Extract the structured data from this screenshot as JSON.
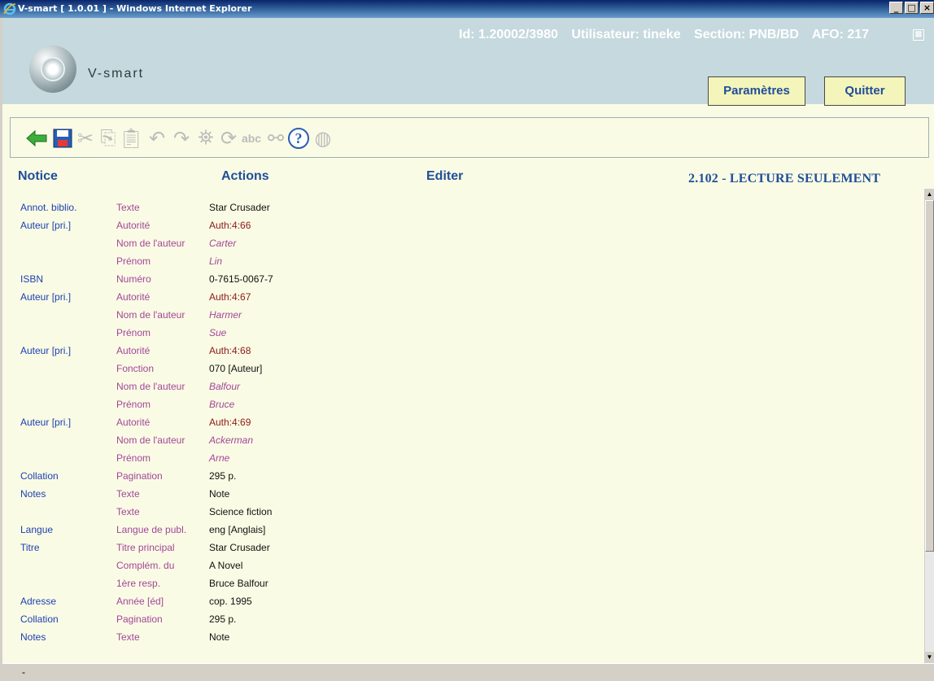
{
  "window": {
    "title": "V-smart [ 1.0.01 ] - Windows Internet Explorer",
    "controls": [
      "_",
      "□",
      "×"
    ]
  },
  "header": {
    "brand": "V-smart",
    "id": "Id: 1.20002/3980",
    "user": "Utilisateur: tineke",
    "section": "Section: PNB/BD",
    "afo": "AFO: 217",
    "close": "⊠",
    "params_button": "Paramètres",
    "quit_button": "Quitter"
  },
  "toolbar": {
    "icons": [
      "back-arrow-icon",
      "save-icon",
      "cut-icon",
      "copy-icon",
      "paste-icon",
      "undo-icon",
      "redo-icon",
      "binoculars-icon",
      "refresh-icon",
      "spellcheck-icon",
      "glasses-icon",
      "help-icon",
      "search-globe-icon"
    ]
  },
  "columns": {
    "notice": "Notice",
    "actions": "Actions",
    "editer": "Editer",
    "mode": "2.102 - LECTURE SEULEMENT"
  },
  "records": [
    {
      "tag": "Annot. biblio.",
      "sub": "Texte",
      "value": "Star Crusader",
      "style": "plain"
    },
    {
      "tag": "Auteur [pri.]",
      "sub": "Autorité",
      "value": "Auth:4:66",
      "style": "auth"
    },
    {
      "tag": "",
      "sub": "Nom de l'auteur",
      "value": "Carter",
      "style": "italic"
    },
    {
      "tag": "",
      "sub": "Prénom",
      "value": "Lin",
      "style": "italic"
    },
    {
      "tag": "ISBN",
      "sub": "Numéro",
      "value": "0-7615-0067-7",
      "style": "plain"
    },
    {
      "tag": "Auteur [pri.]",
      "sub": "Autorité",
      "value": "Auth:4:67",
      "style": "auth"
    },
    {
      "tag": "",
      "sub": "Nom de l'auteur",
      "value": "Harmer",
      "style": "italic"
    },
    {
      "tag": "",
      "sub": "Prénom",
      "value": "Sue",
      "style": "italic"
    },
    {
      "tag": "Auteur [pri.]",
      "sub": "Autorité",
      "value": "Auth:4:68",
      "style": "auth"
    },
    {
      "tag": "",
      "sub": "Fonction",
      "value": "070 [Auteur]",
      "style": "plain"
    },
    {
      "tag": "",
      "sub": "Nom de l'auteur",
      "value": "Balfour",
      "style": "italic"
    },
    {
      "tag": "",
      "sub": "Prénom",
      "value": "Bruce",
      "style": "italic"
    },
    {
      "tag": "Auteur [pri.]",
      "sub": "Autorité",
      "value": "Auth:4:69",
      "style": "auth"
    },
    {
      "tag": "",
      "sub": "Nom de l'auteur",
      "value": "Ackerman",
      "style": "italic"
    },
    {
      "tag": "",
      "sub": "Prénom",
      "value": "Arne",
      "style": "italic"
    },
    {
      "tag": "Collation",
      "sub": "Pagination",
      "value": "295 p.",
      "style": "plain"
    },
    {
      "tag": "Notes",
      "sub": "Texte",
      "value": "Note",
      "style": "plain"
    },
    {
      "tag": "",
      "sub": "Texte",
      "value": "Science fiction",
      "style": "plain"
    },
    {
      "tag": "Langue",
      "sub": "Langue de publ.",
      "value": "eng [Anglais]",
      "style": "plain"
    },
    {
      "tag": "Titre",
      "sub": "Titre principal",
      "value": "Star Crusader",
      "style": "plain"
    },
    {
      "tag": "",
      "sub": "Complém. du",
      "value": "A Novel",
      "style": "plain"
    },
    {
      "tag": "",
      "sub": "1ère resp.",
      "value": "Bruce Balfour",
      "style": "plain"
    },
    {
      "tag": "Adresse",
      "sub": "Année [éd]",
      "value": "cop. 1995",
      "style": "plain"
    },
    {
      "tag": "Collation",
      "sub": "Pagination",
      "value": "295 p.",
      "style": "plain"
    },
    {
      "tag": "Notes",
      "sub": "Texte",
      "value": "Note",
      "style": "plain"
    }
  ],
  "statusbar": {
    "text": "-"
  }
}
